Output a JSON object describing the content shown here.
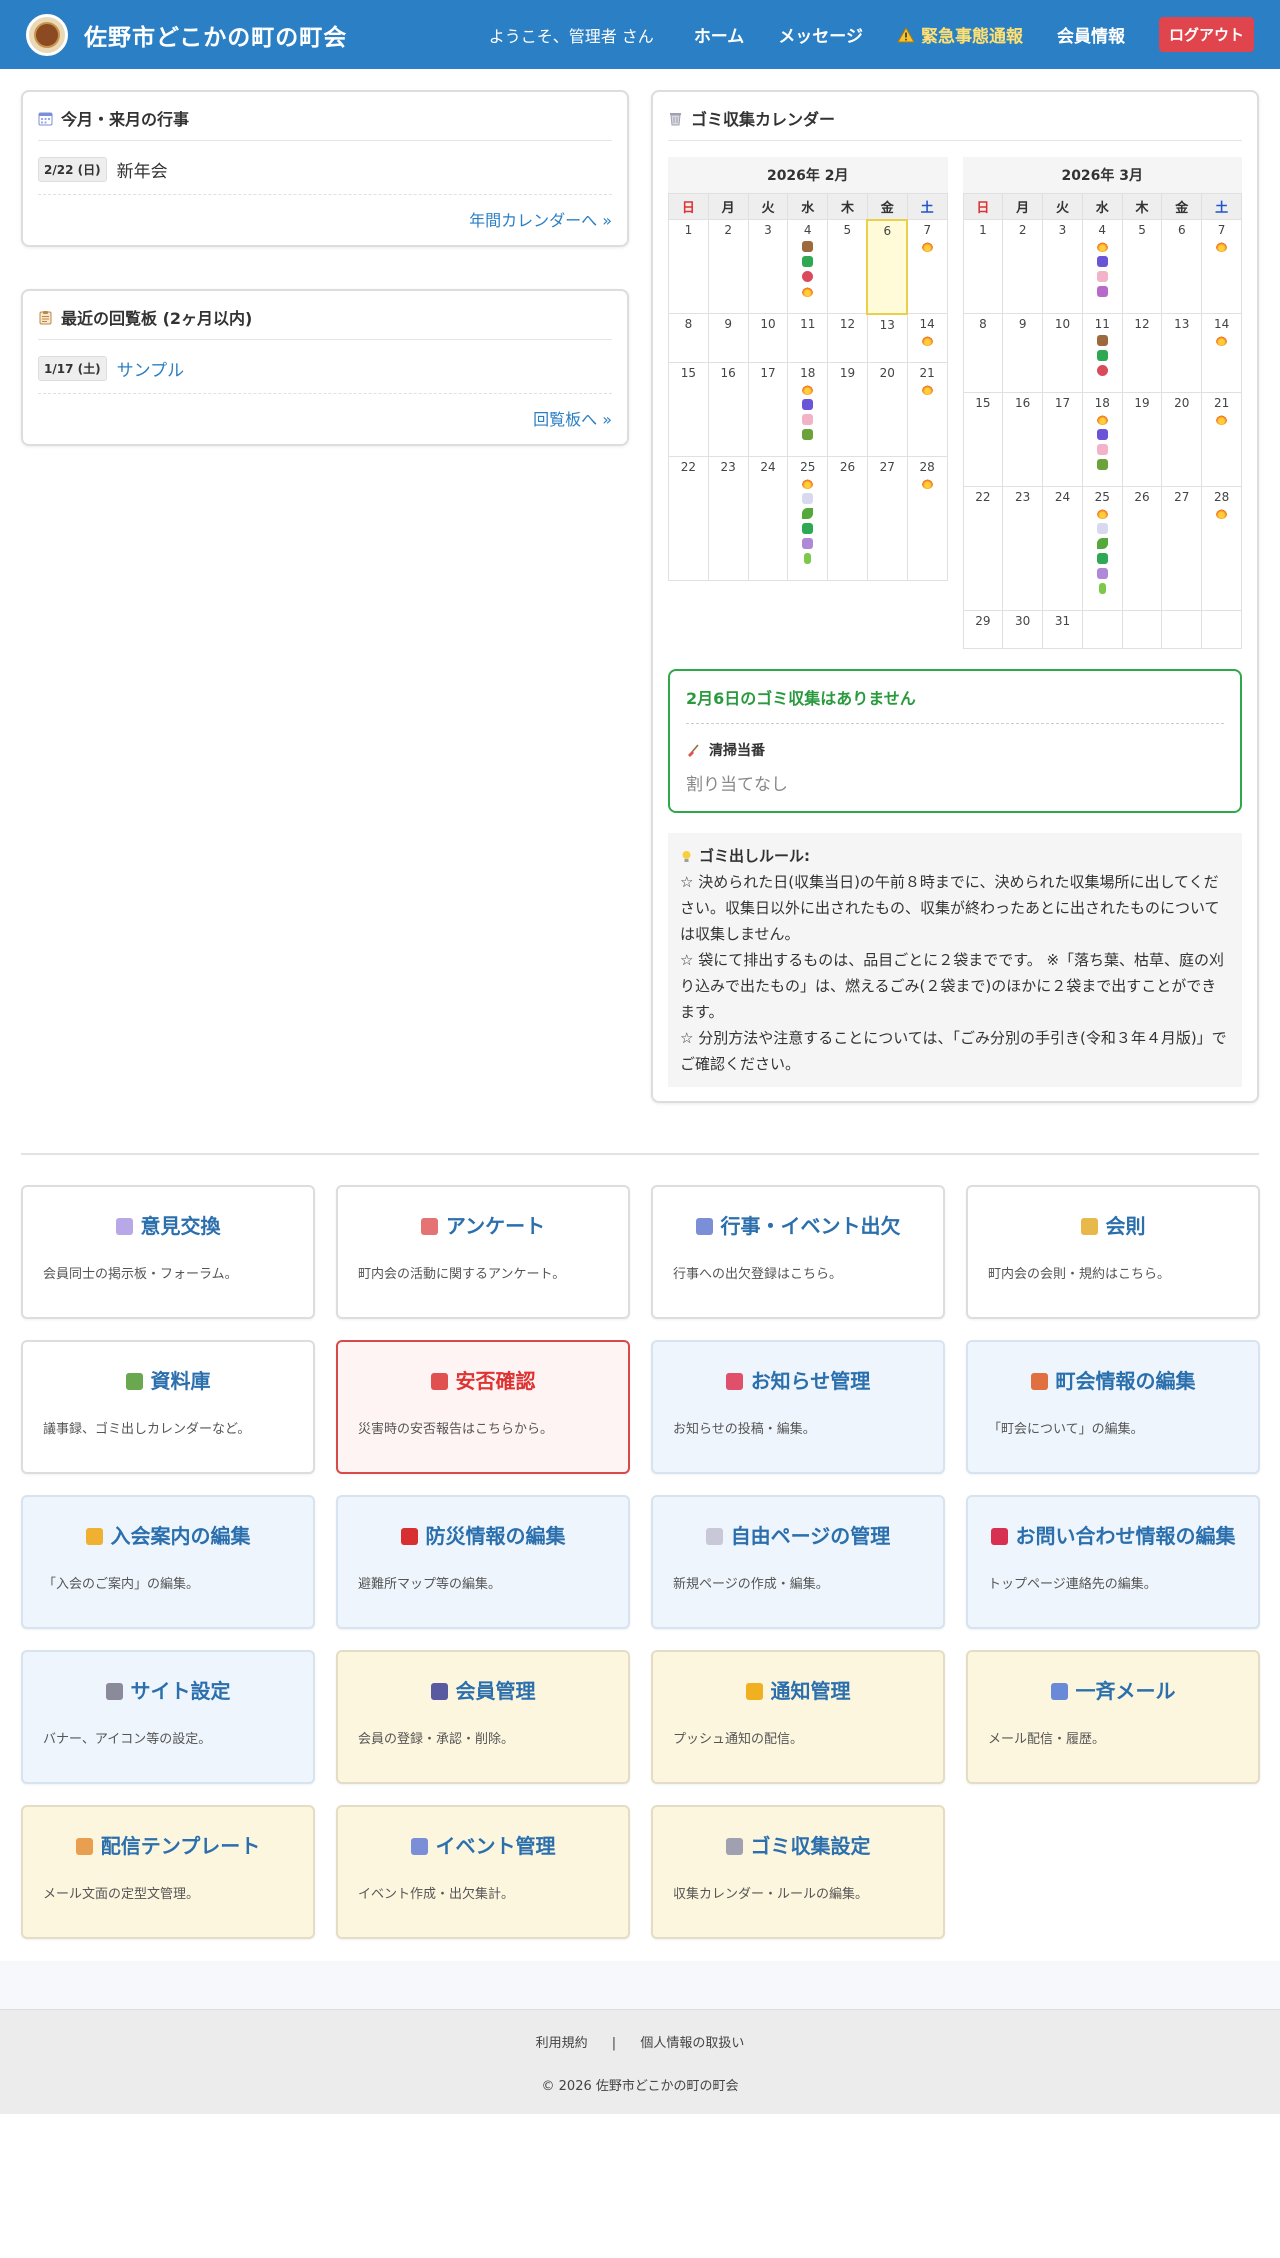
{
  "header": {
    "title": "佐野市どこかの町の町会",
    "welcome": "ようこそ、管理者 さん",
    "nav": {
      "home": "ホーム",
      "messages": "メッセージ",
      "emergency": "緊急事態通報",
      "member_info": "会員情報",
      "logout": "ログアウト"
    }
  },
  "events_panel": {
    "title": "今月・来月の行事",
    "items": [
      {
        "date": "2/22 (日)",
        "text": "新年会"
      }
    ],
    "more": "年間カレンダーへ »"
  },
  "board_panel": {
    "title": "最近の回覧板 (2ヶ月以内)",
    "items": [
      {
        "date": "1/17 (土)",
        "text": "サンプル"
      }
    ],
    "more": "回覧板へ »"
  },
  "garbage": {
    "title": "ゴミ収集カレンダー",
    "weekdays": [
      "日",
      "月",
      "火",
      "水",
      "木",
      "金",
      "土"
    ],
    "calendars": [
      {
        "title": "2026年 2月",
        "weeks": [
          [
            {
              "d": "1"
            },
            {
              "d": "2"
            },
            {
              "d": "3"
            },
            {
              "d": "4",
              "icons": [
                "box",
                "cloth",
                "scissors",
                "burn"
              ]
            },
            {
              "d": "5"
            },
            {
              "d": "6",
              "today": true
            },
            {
              "d": "7",
              "icons": [
                "burn"
              ]
            }
          ],
          [
            {
              "d": "8"
            },
            {
              "d": "9"
            },
            {
              "d": "10"
            },
            {
              "d": "11"
            },
            {
              "d": "12"
            },
            {
              "d": "13"
            },
            {
              "d": "14",
              "icons": [
                "burn"
              ]
            }
          ],
          [
            {
              "d": "15"
            },
            {
              "d": "16"
            },
            {
              "d": "17"
            },
            {
              "d": "18",
              "icons": [
                "burn",
                "bottle",
                "pet",
                "glass"
              ]
            },
            {
              "d": "19"
            },
            {
              "d": "20"
            },
            {
              "d": "21",
              "icons": [
                "burn"
              ]
            }
          ],
          [
            {
              "d": "22"
            },
            {
              "d": "23"
            },
            {
              "d": "24"
            },
            {
              "d": "25",
              "icons": [
                "burn",
                "paper",
                "plant",
                "cloth",
                "basket",
                "battery"
              ]
            },
            {
              "d": "26"
            },
            {
              "d": "27"
            },
            {
              "d": "28",
              "icons": [
                "burn"
              ]
            }
          ]
        ]
      },
      {
        "title": "2026年 3月",
        "weeks": [
          [
            {
              "d": "1"
            },
            {
              "d": "2"
            },
            {
              "d": "3"
            },
            {
              "d": "4",
              "icons": [
                "burn",
                "bottle",
                "pet",
                "can"
              ]
            },
            {
              "d": "5"
            },
            {
              "d": "6"
            },
            {
              "d": "7",
              "icons": [
                "burn"
              ]
            }
          ],
          [
            {
              "d": "8"
            },
            {
              "d": "9"
            },
            {
              "d": "10"
            },
            {
              "d": "11",
              "icons": [
                "box",
                "cloth",
                "scissors"
              ]
            },
            {
              "d": "12"
            },
            {
              "d": "13"
            },
            {
              "d": "14",
              "icons": [
                "burn"
              ]
            }
          ],
          [
            {
              "d": "15"
            },
            {
              "d": "16"
            },
            {
              "d": "17"
            },
            {
              "d": "18",
              "icons": [
                "burn",
                "bottle",
                "pet",
                "glass"
              ]
            },
            {
              "d": "19"
            },
            {
              "d": "20"
            },
            {
              "d": "21",
              "icons": [
                "burn"
              ]
            }
          ],
          [
            {
              "d": "22"
            },
            {
              "d": "23"
            },
            {
              "d": "24"
            },
            {
              "d": "25",
              "icons": [
                "burn",
                "paper",
                "plant",
                "cloth",
                "basket",
                "battery"
              ]
            },
            {
              "d": "26"
            },
            {
              "d": "27"
            },
            {
              "d": "28",
              "icons": [
                "burn"
              ]
            }
          ],
          [
            {
              "d": "29"
            },
            {
              "d": "30"
            },
            {
              "d": "31"
            },
            {
              "d": ""
            },
            {
              "d": ""
            },
            {
              "d": ""
            },
            {
              "d": ""
            }
          ]
        ]
      }
    ],
    "no_collection": "2月6日のゴミ収集はありません",
    "cleaning_label": "清掃当番",
    "cleaning_value": "割り当てなし",
    "rules_title": "ゴミ出しルール:",
    "rules_text": "☆ 決められた日(収集当日)の午前８時までに、決められた収集場所に出してください。収集日以外に出されたもの、収集が終わったあとに出されたものについては収集しません。\n☆ 袋にて排出するものは、品目ごとに２袋までです。 ※「落ち葉、枯草、庭の刈り込みで出たもの」は、燃えるごみ(２袋まで)のほかに２袋まで出すことができます。\n☆ 分別方法や注意することについては、「ごみ分別の手引き(令和３年４月版)」でご確認ください。"
  },
  "tiles": [
    {
      "title": "意見交換",
      "desc": "会員同士の掲示板・フォーラム。",
      "style": "white",
      "icon": "speech-bubble-icon",
      "color": "#b9a8e8"
    },
    {
      "title": "アンケート",
      "desc": "町内会の活動に関するアンケート。",
      "style": "white",
      "icon": "bar-chart-icon",
      "color": "#e57373"
    },
    {
      "title": "行事・イベント出欠",
      "desc": "行事への出欠登録はこちら。",
      "style": "white",
      "icon": "calendar-icon",
      "color": "#7a8fd8"
    },
    {
      "title": "会則",
      "desc": "町内会の会則・規約はこちら。",
      "style": "white",
      "icon": "scroll-icon",
      "color": "#e8b84a"
    },
    {
      "title": "資料庫",
      "desc": "議事録、ゴミ出しカレンダーなど。",
      "style": "white",
      "icon": "books-icon",
      "color": "#6aa84f"
    },
    {
      "title": "安否確認",
      "desc": "災害時の安否報告はこちらから。",
      "style": "danger",
      "icon": "helmet-icon",
      "color": "#e05050"
    },
    {
      "title": "お知らせ管理",
      "desc": "お知らせの投稿・編集。",
      "style": "blue",
      "icon": "megaphone-icon",
      "color": "#e0506a"
    },
    {
      "title": "町会情報の編集",
      "desc": "「町会について」の編集。",
      "style": "blue",
      "icon": "houses-icon",
      "color": "#e07040"
    },
    {
      "title": "入会案内の編集",
      "desc": "「入会のご案内」の編集。",
      "style": "blue",
      "icon": "handshake-icon",
      "color": "#f0b030"
    },
    {
      "title": "防災情報の編集",
      "desc": "避難所マップ等の編集。",
      "style": "blue",
      "icon": "rescue-helmet-icon",
      "color": "#d83030"
    },
    {
      "title": "自由ページの管理",
      "desc": "新規ページの作成・編集。",
      "style": "blue",
      "icon": "page-icon",
      "color": "#c8c8d8"
    },
    {
      "title": "お問い合わせ情報の編集",
      "desc": "トップページ連絡先の編集。",
      "style": "blue",
      "icon": "phone-icon",
      "color": "#d83050"
    },
    {
      "title": "サイト設定",
      "desc": "バナー、アイコン等の設定。",
      "style": "blue",
      "icon": "gear-icon",
      "color": "#8a8a9a"
    },
    {
      "title": "会員管理",
      "desc": "会員の登録・承認・削除。",
      "style": "yellow",
      "icon": "people-icon",
      "color": "#5a5aa0"
    },
    {
      "title": "通知管理",
      "desc": "プッシュ通知の配信。",
      "style": "yellow",
      "icon": "bell-icon",
      "color": "#f0b020"
    },
    {
      "title": "一斉メール",
      "desc": "メール配信・履歴。",
      "style": "yellow",
      "icon": "mail-icon",
      "color": "#6a8ad8"
    },
    {
      "title": "配信テンプレート",
      "desc": "メール文面の定型文管理。",
      "style": "yellow",
      "icon": "memo-icon",
      "color": "#e8a050"
    },
    {
      "title": "イベント管理",
      "desc": "イベント作成・出欠集計。",
      "style": "yellow",
      "icon": "calendar-icon",
      "color": "#7a8fd8"
    },
    {
      "title": "ゴミ収集設定",
      "desc": "収集カレンダー・ルールの編集。",
      "style": "yellow",
      "icon": "trash-can-icon",
      "color": "#a0a0b0"
    }
  ],
  "footer": {
    "terms": "利用規約",
    "separator": "|",
    "privacy": "個人情報の取扱い",
    "copyright": "© 2026 佐野市どこかの町の町会"
  }
}
